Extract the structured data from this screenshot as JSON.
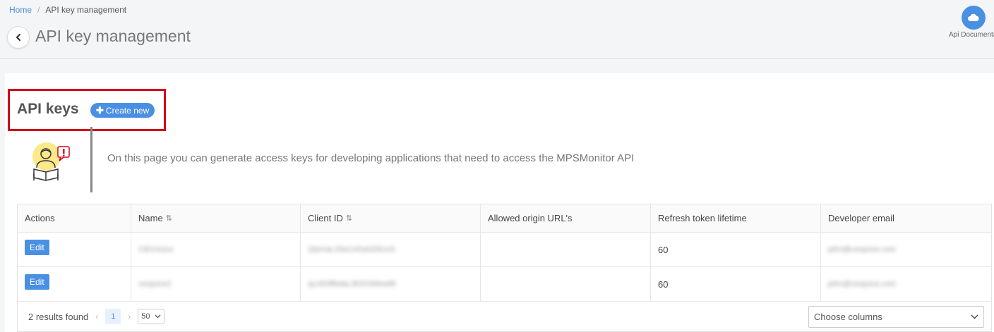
{
  "breadcrumb": {
    "home": "Home",
    "separator": "/",
    "current": "API key management"
  },
  "header": {
    "title": "API key management"
  },
  "api_doc": {
    "label": "Api Documentat",
    "icon": "cloud-icon"
  },
  "section": {
    "title": "API keys",
    "create_label": "Create new",
    "intro": "On this page you can generate access keys for developing applications that need to access the MPSMonitor API"
  },
  "table": {
    "headers": {
      "actions": "Actions",
      "name": "Name",
      "client_id": "Client ID",
      "origins": "Allowed origin URL's",
      "lifetime": "Refresh token lifetime",
      "email": "Developer email"
    },
    "rows": [
      {
        "action": "Edit",
        "name": "CEOJuice",
        "client_id": "QlymaL33w14Sa0Z6UuS",
        "origins": "",
        "lifetime": "60",
        "email": "john@ceojuice.com"
      },
      {
        "action": "Edit",
        "name": "ceojuice2",
        "client_id": "qLt309fbdaL3b3VbMoeBt",
        "origins": "",
        "lifetime": "60",
        "email": "john@ceojuice.com"
      }
    ]
  },
  "footer": {
    "results": "2 results found",
    "current_page": "1",
    "per_page": "50",
    "choose_columns": "Choose columns"
  },
  "colors": {
    "accent": "#4a90e2",
    "highlight": "#d0021b"
  }
}
